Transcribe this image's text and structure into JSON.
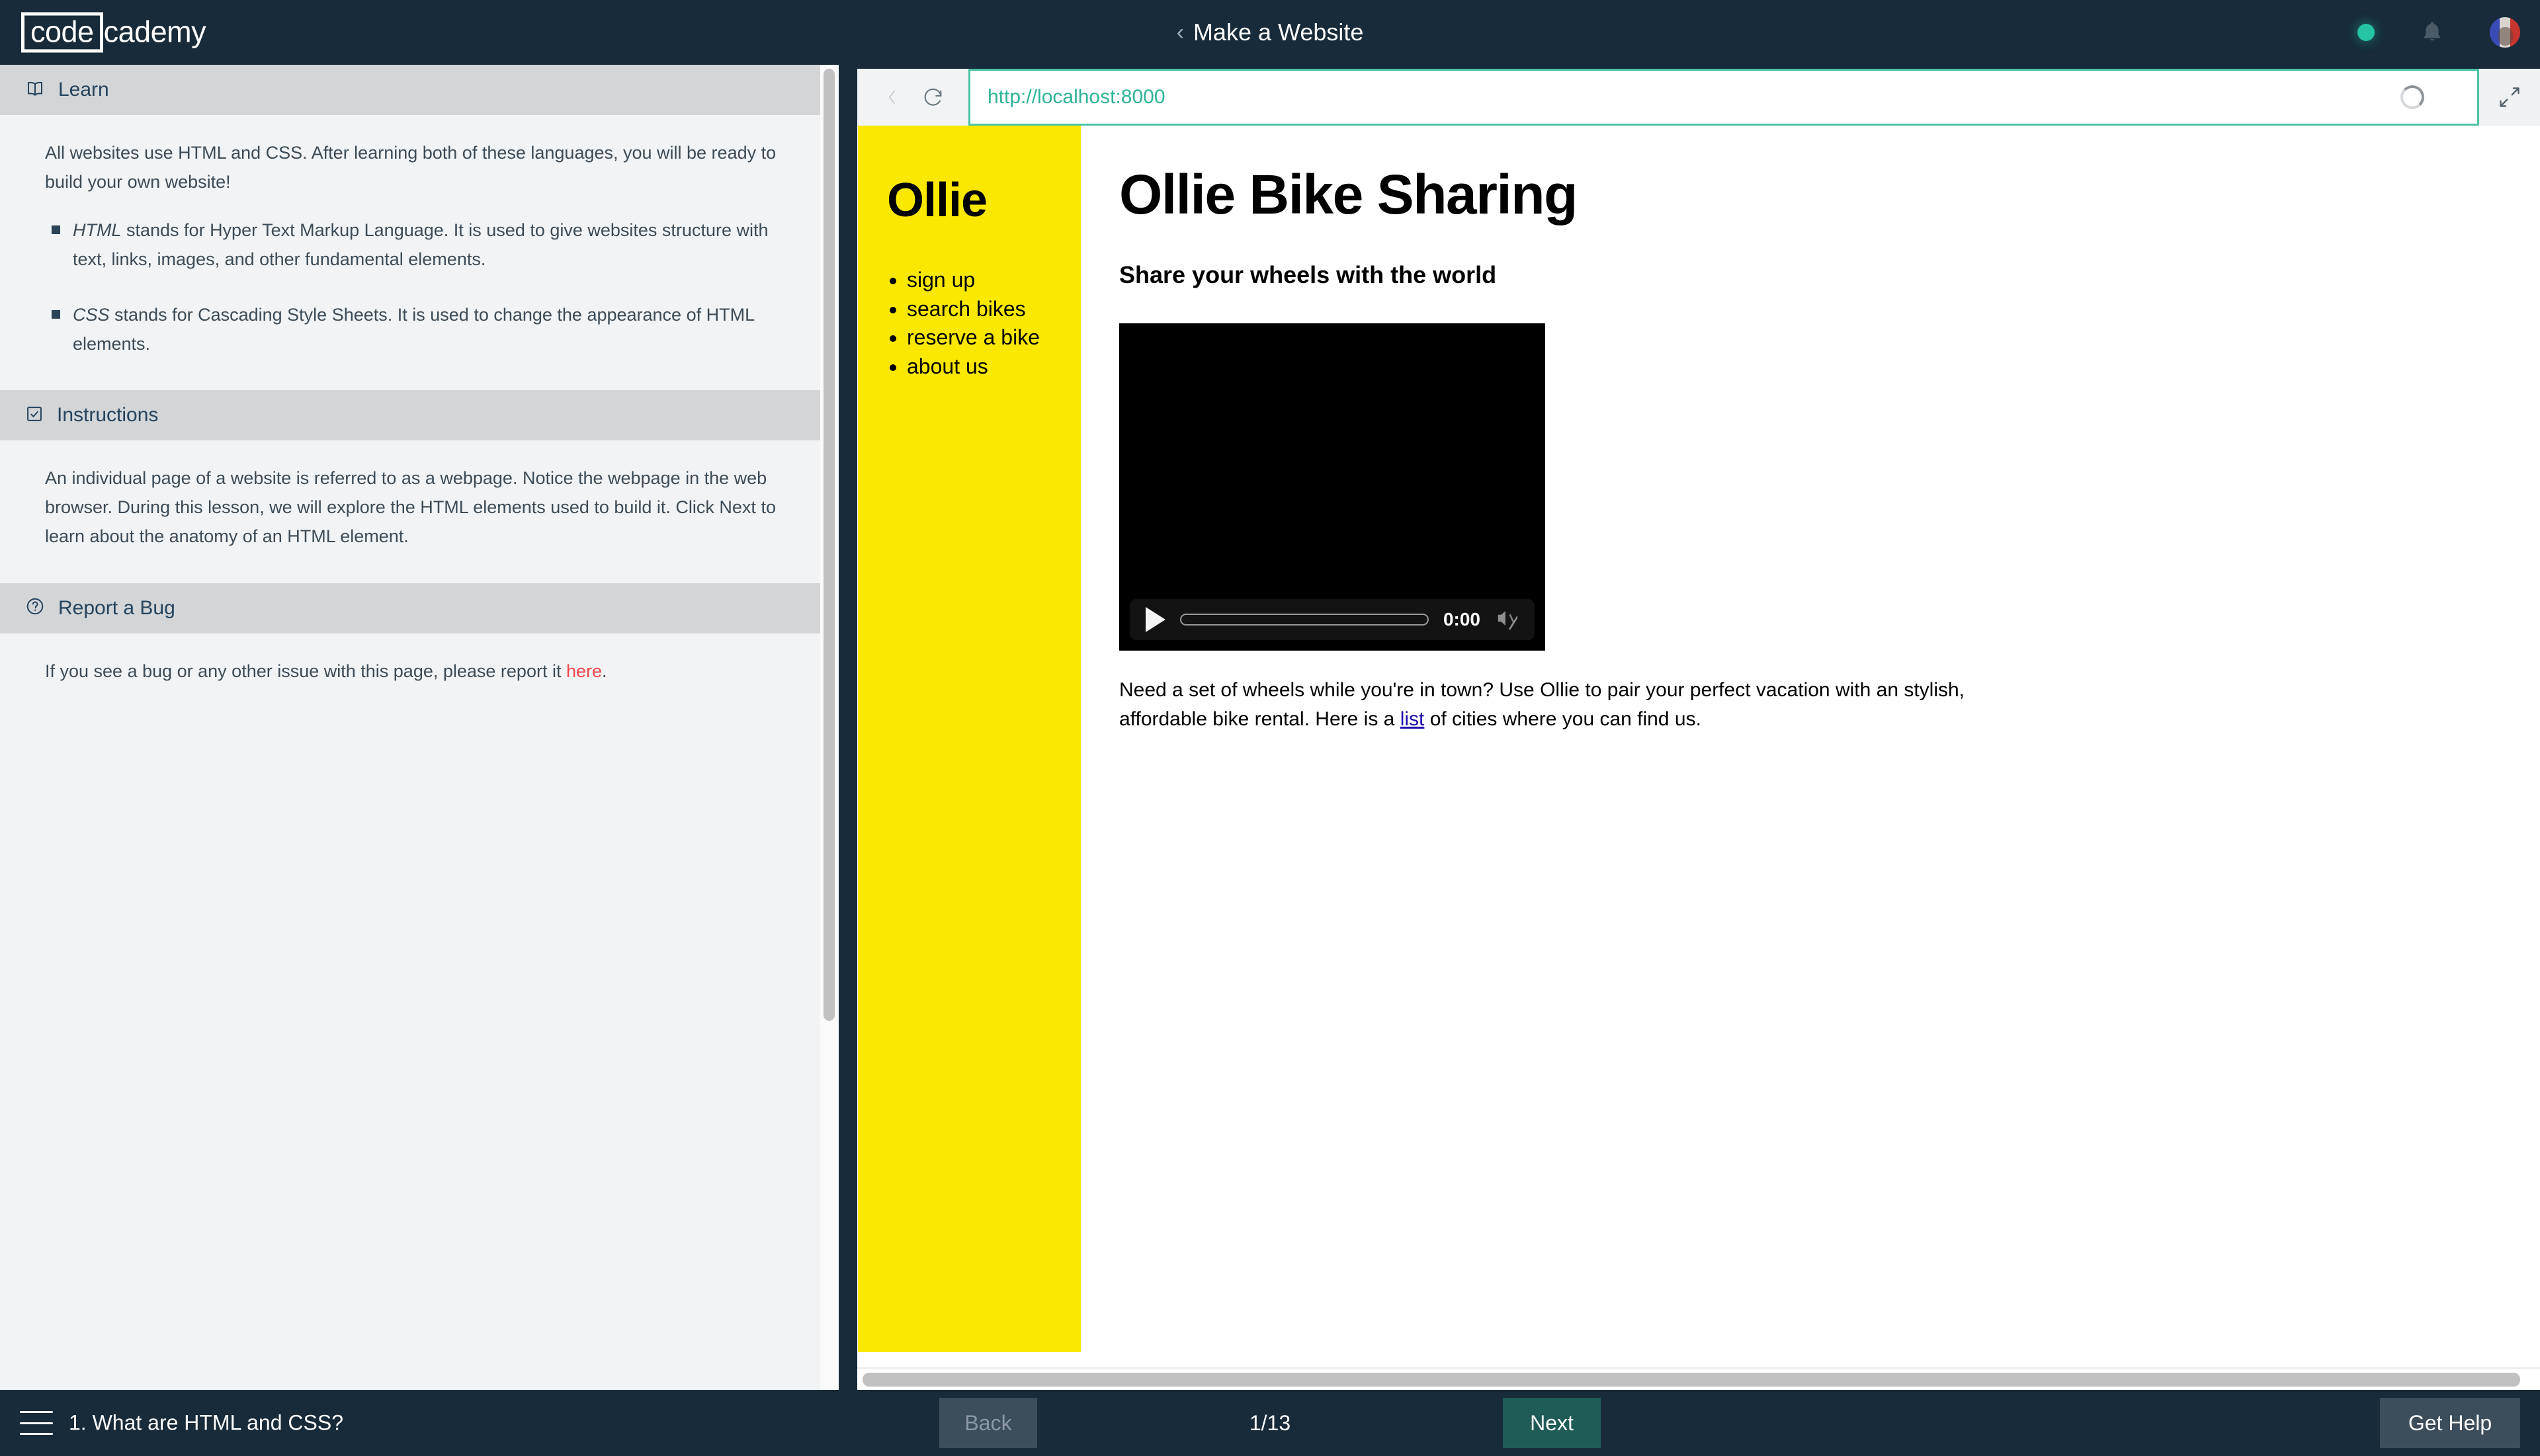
{
  "header": {
    "logo_box": "code",
    "logo_rest": "cademy",
    "back_chevron": "‹",
    "title": "Make a Website",
    "status_dot_color": "#26c4a4",
    "notifications_icon": "bell-icon",
    "avatar_label": "user-avatar"
  },
  "left_panel": {
    "sections": [
      {
        "icon": "book-icon",
        "title": "Learn",
        "paragraph": "All websites use HTML and CSS. After learning both of these languages, you will be ready to build your own website!",
        "bullets": [
          {
            "term": "HTML",
            "text": " stands for Hyper Text Markup Language. It is used to give websites structure with text, links, images, and other fundamental elements."
          },
          {
            "term": "CSS",
            "text": " stands for Cascading Style Sheets. It is used to change the appearance of HTML elements."
          }
        ]
      },
      {
        "icon": "checkbox-icon",
        "title": "Instructions",
        "paragraph": "An individual page of a website is referred to as a webpage. Notice the webpage in the web browser. During this lesson, we will explore the HTML elements used to build it. Click Next to learn about the anatomy of an HTML element."
      },
      {
        "icon": "question-circle-icon",
        "title": "Report a Bug",
        "paragraph_before": "If you see a bug or any other issue with this page, please report it ",
        "link_text": "here",
        "paragraph_after": ".",
        "link_color": "#f0464a"
      }
    ]
  },
  "browser": {
    "back_icon": "chevron-left-icon",
    "reload_icon": "reload-icon",
    "url": "http://localhost:8000",
    "url_accent_color": "#4cc2a5",
    "spinner_icon": "loading-spinner-icon",
    "expand_icon": "expand-icon"
  },
  "webpage": {
    "sidebar": {
      "brand": "Ollie",
      "background_color": "#fae800",
      "nav_items": [
        "sign up",
        "search bikes",
        "reserve a bike",
        "about us"
      ]
    },
    "main": {
      "h1": "Ollie Bike Sharing",
      "h3": "Share your wheels with the world",
      "video": {
        "play_icon": "play-icon",
        "time": "0:00",
        "mute_icon": "volume-muted-icon"
      },
      "paragraph_before": "Need a set of wheels while you're in town? Use Ollie to pair your perfect vacation with an stylish, affordable bike rental. Here is a ",
      "link_text": "list",
      "paragraph_after": " of cities where you can find us.",
      "link_color": "#1a0dab"
    }
  },
  "bottom_bar": {
    "menu_icon": "hamburger-menu-icon",
    "lesson_title": "1. What are HTML and CSS?",
    "back_label": "Back",
    "progress": "1/13",
    "next_label": "Next",
    "help_label": "Get Help",
    "next_color": "#1f5c58"
  }
}
